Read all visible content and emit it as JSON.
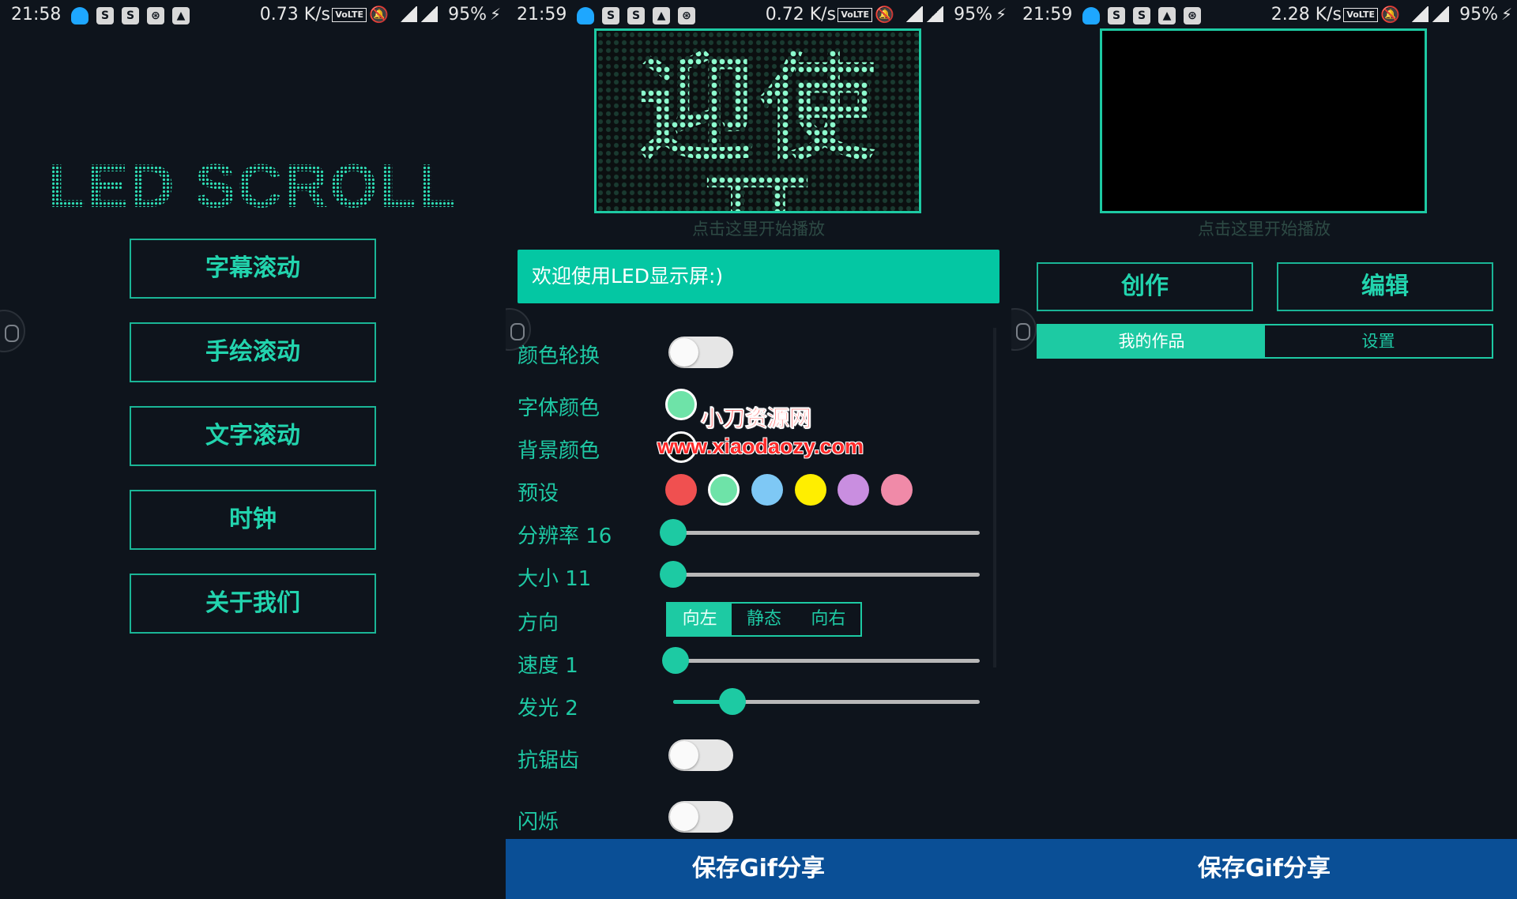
{
  "status_bars": [
    {
      "time": "21:58",
      "speed": "0.73 K/s",
      "volte": "VoLTE",
      "battery": "95%"
    },
    {
      "time": "21:59",
      "speed": "0.72 K/s",
      "volte": "VoLTE",
      "battery": "95%"
    },
    {
      "time": "21:59",
      "speed": "2.28 K/s",
      "volte": "VoLTE",
      "battery": "95%"
    }
  ],
  "home": {
    "logo": "LED SCROLL",
    "menu": [
      "字幕滚动",
      "手绘滚动",
      "文字滚动",
      "时钟",
      "关于我们"
    ]
  },
  "editor": {
    "led_preview_text": "迎使开",
    "hint": "点击这里开始播放",
    "input_text": "欢迎使用LED显示屏:)",
    "labels": {
      "color_cycle": "颜色轮换",
      "font_color": "字体颜色",
      "bg_color": "背景颜色",
      "preset": "预设",
      "resolution": "分辨率 16",
      "size": "大小 11",
      "direction": "方向",
      "speed": "速度 1",
      "glow": "发光 2",
      "antialias": "抗锯齿",
      "blink": "闪烁"
    },
    "preset_colors": [
      "#f05050",
      "#6ee3a8",
      "#7ec8f5",
      "#ffee00",
      "#c98ee0",
      "#f08aa8"
    ],
    "font_color": "#6ee3a8",
    "direction_options": [
      "向左",
      "静态",
      "向右"
    ],
    "direction_selected": "向左",
    "resolution_value": 16,
    "size_value": 11,
    "speed_value": 1,
    "glow_value": 2,
    "color_cycle_on": false,
    "antialias_on": false,
    "blink_on": false,
    "watermark_name": "小刀资源网",
    "watermark_url": "www.xiaodaozy.com",
    "save_label": "保存Gif分享"
  },
  "works": {
    "hint": "点击这里开始播放",
    "create_label": "创作",
    "edit_label": "编辑",
    "tabs": [
      "我的作品",
      "设置"
    ],
    "active_tab": "我的作品",
    "save_label": "保存Gif分享"
  },
  "colors": {
    "accent": "#1dcaa3",
    "background": "#0e141c",
    "save_bar": "#0a4f96"
  }
}
